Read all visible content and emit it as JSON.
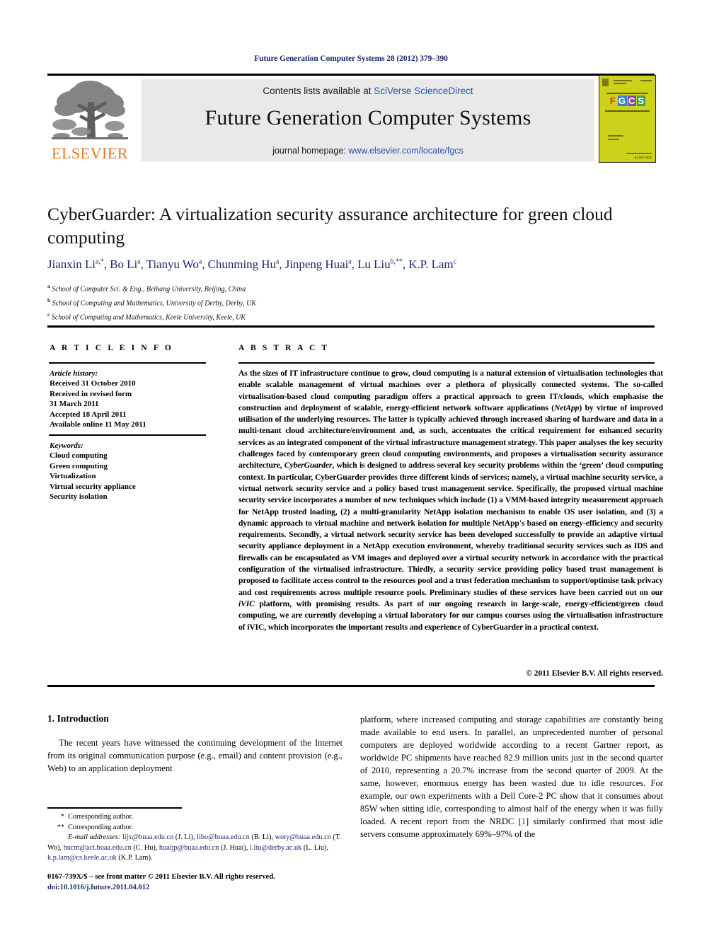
{
  "running_head": "Future Generation Computer Systems 28 (2012) 379–390",
  "masthead": {
    "publisher": "ELSEVIER",
    "contents_prefix": "Contents lists available at ",
    "contents_link": "SciVerse ScienceDirect",
    "journal_title": "Future Generation Computer Systems",
    "homepage_prefix": "journal homepage: ",
    "homepage_link": "www.elsevier.com/locate/fgcs",
    "cover": {
      "letters": [
        "F",
        "G",
        "C",
        "S"
      ],
      "background_color": "#cdd11a",
      "imprint": "ELSEVIER"
    }
  },
  "article": {
    "title": "CyberGuarder: A virtualization security assurance architecture for green cloud computing",
    "authors_html": "Jianxin Li<sup>a,*</sup>, Bo Li<sup>a</sup>, Tianyu Wo<sup>a</sup>, Chunming Hu<sup>a</sup>, Jinpeng Huai<sup>a</sup>, Lu Liu<sup>b,**</sup>, K.P. Lam<sup>c</sup>",
    "affiliations": [
      {
        "marker": "a",
        "text": "School of Computer Sci. & Eng., Beihang University, Beijing, China"
      },
      {
        "marker": "b",
        "text": "School of Computing and Mathematics, University of Derby, Derby, UK"
      },
      {
        "marker": "c",
        "text": "School of Computing and Mathematics, Keele University, Keele, UK"
      }
    ]
  },
  "info": {
    "header": "A R T I C L E   I N F O",
    "history_label": "Article history:",
    "history": [
      "Received 31 October 2010",
      "Received in revised form",
      "31 March 2011",
      "Accepted 18 April 2011",
      "Available online 11 May 2011"
    ],
    "keywords_label": "Keywords:",
    "keywords": [
      "Cloud computing",
      "Green computing",
      "Virtualization",
      "Virtual security appliance",
      "Security isolation"
    ]
  },
  "abstract": {
    "header": "A B S T R A C T",
    "text_html": "As the sizes of IT infrastructure continue to grow, cloud computing is a natural extension of virtualisation technologies that enable scalable management of virtual machines over a plethora of physically connected systems. The so-called virtualisation-based cloud computing paradigm offers a practical approach to green IT/clouds, which emphasise the construction and deployment of scalable, energy-efficient network software applications (<i>NetApp</i>) by virtue of improved utilisation of the underlying resources. The latter is typically achieved through increased sharing of hardware and data in a multi-tenant cloud architecture/environment and, as such, accentuates the critical requirement for enhanced security services as an integrated component of the virtual infrastructure management strategy. This paper analyses the key security challenges faced by contemporary green cloud computing environments, and proposes a virtualisation security assurance architecture, <i>CyberGuarder</i>, which is designed to address several key security problems within the ‘green’ cloud computing context. In particular, CyberGuarder provides three different kinds of services; namely, a virtual machine security service, a virtual network security service and a policy based trust management service. Specifically, the proposed virtual machine security service incorporates a number of new techniques which include (1) a VMM-based integrity measurement approach for NetApp trusted loading, (2) a multi-granularity NetApp isolation mechanism to enable OS user isolation, and (3) a dynamic approach to virtual machine and network isolation for multiple NetApp's based on energy-efficiency and security requirements. Secondly, a virtual network security service has been developed successfully to provide an adaptive virtual security appliance deployment in a NetApp execution environment, whereby traditional security services such as IDS and firewalls can be encapsulated as VM images and deployed over a virtual security network in accordance with the practical configuration of the virtualised infrastructure. Thirdly, a security service providing policy based trust management is proposed to facilitate access control to the resources pool and a trust federation mechanism to support/optimise task privacy and cost requirements across multiple resource pools. Preliminary studies of these services have been carried out on our <i>iVIC</i> platform, with promising results. As part of our ongoing research in large-scale, energy-efficient/green cloud computing, we are currently developing a virtual laboratory for our campus courses using the virtualisation infrastructure of iVIC, which incorporates the important results and experience of CyberGuarder in a practical context.",
    "copyright": "© 2011 Elsevier B.V. All rights reserved."
  },
  "body": {
    "section_heading": "1. Introduction",
    "left_paragraph": "The recent years have witnessed the continuing development of the Internet from its original communication purpose (e.g., email) and content provision (e.g., Web) to an application deployment",
    "right_paragraph_html": "platform, where increased computing and storage capabilities are constantly being made available to end users. In parallel, an unprecedented number of personal computers are deployed worldwide according to a recent Gartner report, as worldwide PC shipments have reached 82.9 million units just in the second quarter of 2010, representing a 20.7% increase from the second quarter of 2009. At the same, however, enormous energy has been wasted due to idle resources. For example, our own experiments with a Dell Core-2 PC show that it consumes about 85W when sitting idle, corresponding to almost half of the energy when it was fully loaded. A recent report from the NRDC [<span class=\"ref\">1</span>] similarly confirmed that most idle servers consume approximately 69%–97% of the"
  },
  "footnotes": {
    "corresponding_1_marker": "*",
    "corresponding_1_text": "Corresponding author.",
    "corresponding_2_marker": "**",
    "corresponding_2_text": "Corresponding author.",
    "emails_html": "<span class=\"em\">E-mail addresses:</span> <span class=\"mail\">lijx@buaa.edu.cn</span> (J. Li), <span class=\"mail\">libo@buaa.edu.cn</span> (B. Li), <span class=\"mail\">woty@buaa.edu.cn</span> (T. Wo), <span class=\"mail\">hucm@act.buaa.edu.cn</span> (C. Hu), <span class=\"mail\">huaijp@buaa.edu.cn</span> (J. Huai), <span class=\"mail\">l.liu@derby.ac.uk</span> (L. Liu), <span class=\"mail\">k.p.lam@cs.keele.ac.uk</span> (K.P. Lam)."
  },
  "imprint": {
    "line1": "0167-739X/$ – see front matter © 2011 Elsevier B.V. All rights reserved.",
    "doi": "doi:10.1016/j.future.2011.04.012"
  }
}
